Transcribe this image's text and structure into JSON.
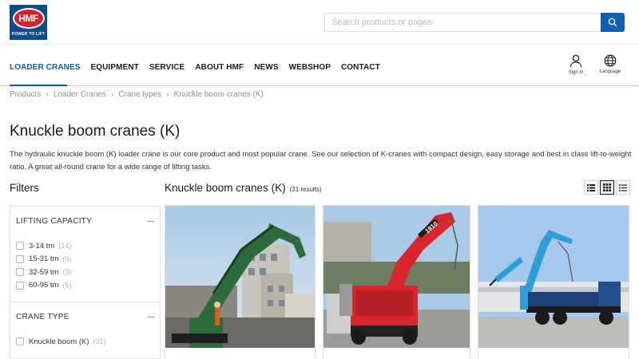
{
  "brand": {
    "logo_text": "HMF",
    "tagline": "POWER TO LIFT"
  },
  "search": {
    "placeholder": "Search products or pages"
  },
  "nav": {
    "items": [
      {
        "label": "LOADER CRANES",
        "active": true
      },
      {
        "label": "EQUIPMENT"
      },
      {
        "label": "SERVICE"
      },
      {
        "label": "ABOUT HMF"
      },
      {
        "label": "NEWS"
      },
      {
        "label": "WEBSHOP"
      },
      {
        "label": "CONTACT"
      }
    ],
    "signin_label": "Sign In",
    "language_label": "Language"
  },
  "breadcrumb": [
    "Products",
    "Loader Cranes",
    "Crane types",
    "Knuckle boom cranes (K)"
  ],
  "page": {
    "title": "Knuckle boom cranes (K)",
    "intro": "The hydraulic knuckle boom (K) loader crane is our core product and most popular crane. See our selection of K-cranes with compact design, easy storage and best in class lift-to-weight ratio. A great all-round crane for a wide range of lifting tasks."
  },
  "filters": {
    "title": "Filters",
    "sections": [
      {
        "label": "LIFTING CAPACITY",
        "options": [
          {
            "label": "3-14 tm",
            "count": "(14)"
          },
          {
            "label": "15-31 tm",
            "count": "(9)"
          },
          {
            "label": "32-59 tm",
            "count": "(3)"
          },
          {
            "label": "60-95 tm",
            "count": "(5)"
          }
        ]
      },
      {
        "label": "CRANE TYPE",
        "options": [
          {
            "label": "Knuckle boom (K)",
            "count": "(31)"
          }
        ]
      }
    ]
  },
  "results": {
    "title": "Knuckle boom cranes (K)",
    "count": "(31 results)",
    "view_modes": [
      "list-view",
      "grid-view",
      "compact-list-view"
    ],
    "active_view": "grid-view",
    "cards": [
      {
        "image": "green-crane-construction-photo",
        "crane_color": "#2e6b3c"
      },
      {
        "image": "red-crane-truck-photo",
        "crane_color": "#d8262c",
        "boom_text": "1910"
      },
      {
        "image": "blue-crane-truck-photo",
        "crane_color": "#2e9fd6"
      }
    ]
  },
  "colors": {
    "brand_blue": "#0f4c8a",
    "accent_blue": "#0f5ba7",
    "brand_red": "#d3232a"
  }
}
